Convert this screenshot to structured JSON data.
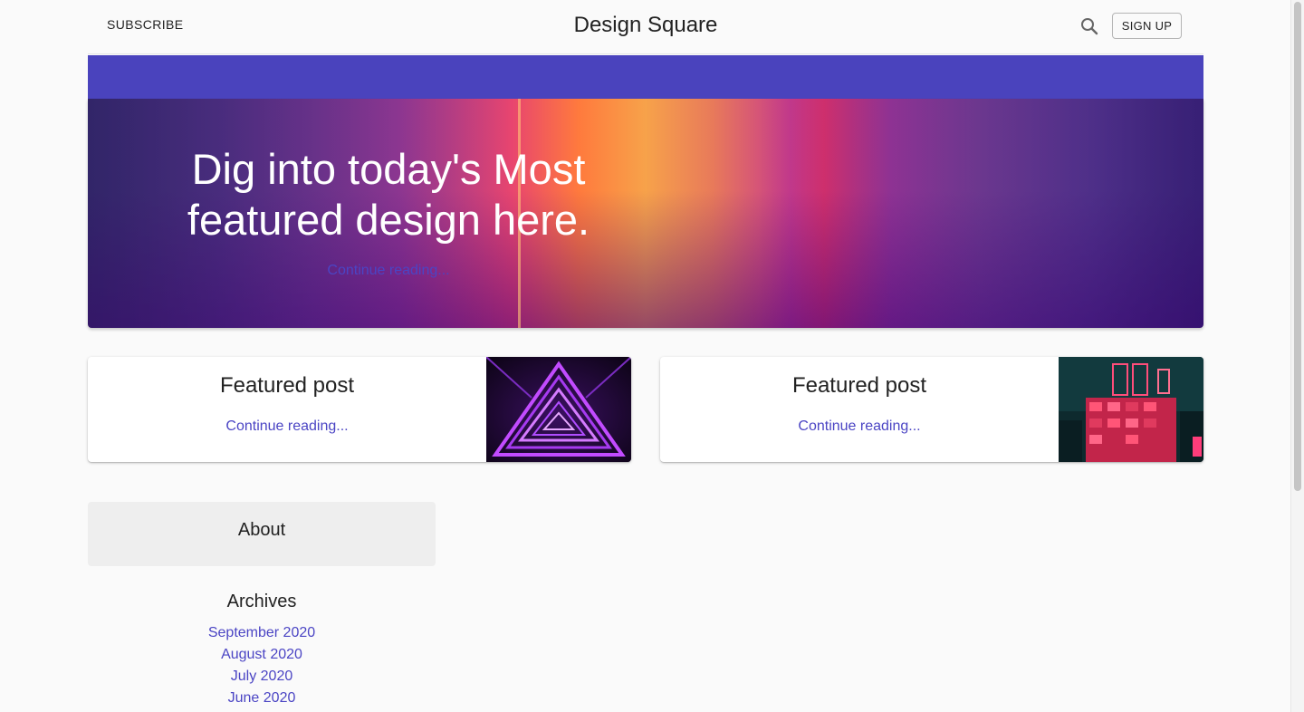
{
  "header": {
    "subscribe_label": "SUBSCRIBE",
    "site_title": "Design Square",
    "search_icon": "search-icon",
    "signup_label": "SIGN UP"
  },
  "hero": {
    "title": "Dig into today's Most featured design here.",
    "link_text": "Continue reading..."
  },
  "featured": [
    {
      "title": "Featured post",
      "link_text": "Continue reading...",
      "image": "neon-triangle-tunnel"
    },
    {
      "title": "Featured post",
      "link_text": "Continue reading...",
      "image": "neon-city-building"
    }
  ],
  "about": {
    "title": "About"
  },
  "archives": {
    "title": "Archives",
    "items": [
      "September 2020",
      "August 2020",
      "July 2020",
      "June 2020"
    ]
  },
  "colors": {
    "accent": "#4a43bd",
    "link": "#4b45c4",
    "background": "#fafafa"
  }
}
